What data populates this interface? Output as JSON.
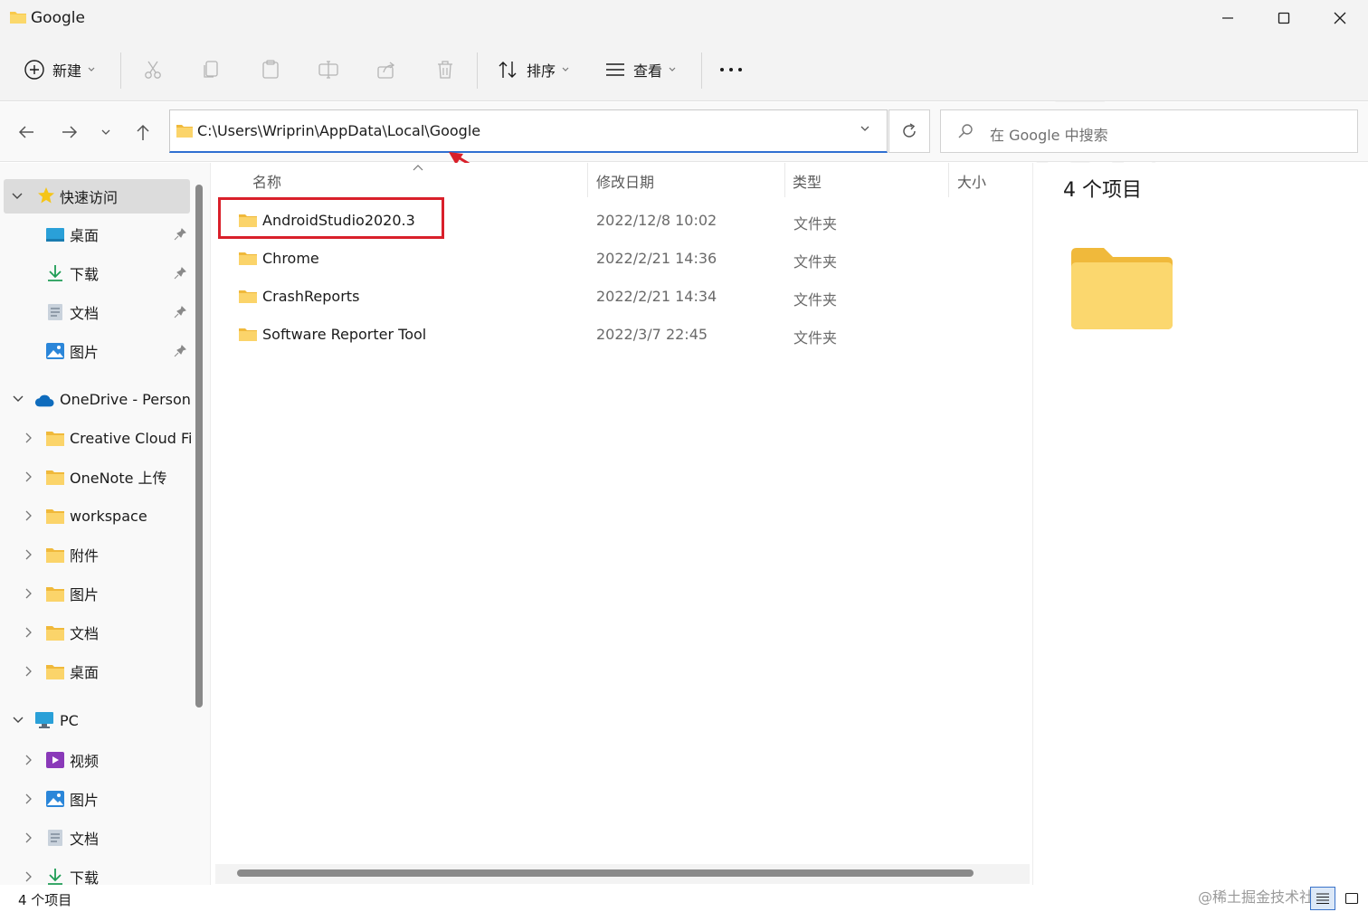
{
  "window": {
    "title": "Google"
  },
  "toolbar": {
    "new_label": "新建",
    "sort_label": "排序",
    "view_label": "查看",
    "more_label": "···"
  },
  "address": {
    "path": "C:\\Users\\Wriprin\\AppData\\Local\\Google"
  },
  "search": {
    "placeholder": "在 Google 中搜索"
  },
  "sidebar": {
    "quick_access": "快速访问",
    "quick_items": [
      "桌面",
      "下载",
      "文档",
      "图片"
    ],
    "onedrive": "OneDrive - Personal",
    "onedrive_items": [
      "Creative Cloud Files",
      "OneNote 上传",
      "workspace",
      "附件",
      "图片",
      "文档",
      "桌面"
    ],
    "pc": "PC",
    "pc_items": [
      "视频",
      "图片",
      "文档",
      "下载"
    ]
  },
  "columns": {
    "name": "名称",
    "modified": "修改日期",
    "type": "类型",
    "size": "大小"
  },
  "files": [
    {
      "name": "AndroidStudio2020.3",
      "modified": "2022/12/8 10:02",
      "type": "文件夹"
    },
    {
      "name": "Chrome",
      "modified": "2022/2/21 14:36",
      "type": "文件夹"
    },
    {
      "name": "CrashReports",
      "modified": "2022/2/21 14:34",
      "type": "文件夹"
    },
    {
      "name": "Software Reporter Tool",
      "modified": "2022/3/7 22:45",
      "type": "文件夹"
    }
  ],
  "details": {
    "count": "4 个项目"
  },
  "status": {
    "count": "4 个项目",
    "watermark": "@稀土掘金技术社区"
  },
  "colors": {
    "accent": "#2f6fd1",
    "highlight": "#d9202a",
    "folder": "#f8d06a"
  }
}
